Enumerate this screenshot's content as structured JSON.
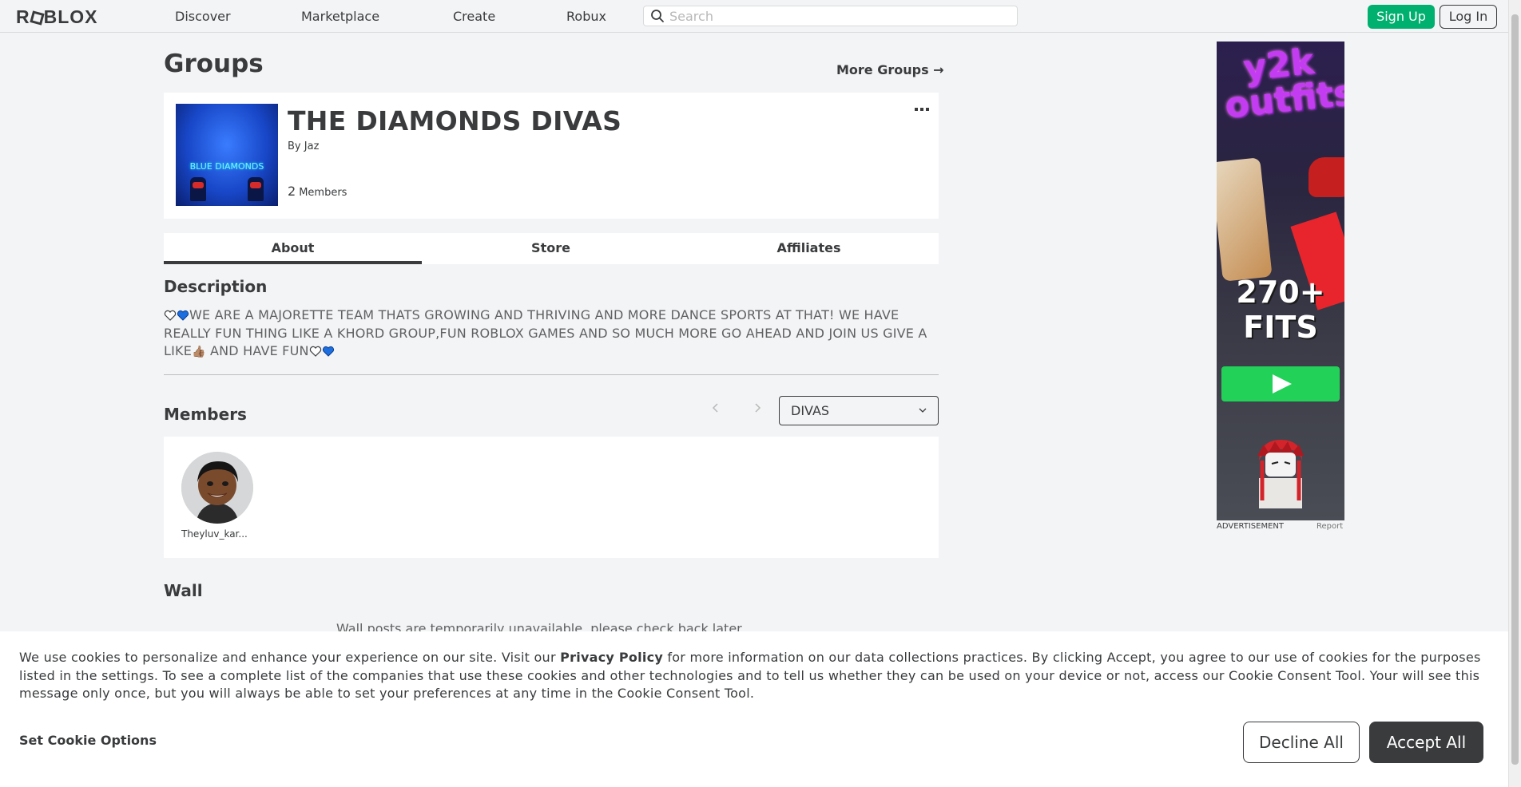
{
  "nav": {
    "logo": "ROBLOX",
    "logo_parts": [
      "R",
      "BLOX"
    ],
    "links": [
      "Discover",
      "Marketplace",
      "Create",
      "Robux"
    ],
    "search_placeholder": "Search",
    "signup": "Sign Up",
    "login": "Log In"
  },
  "page": {
    "title": "Groups",
    "more_groups": "More Groups →"
  },
  "group": {
    "name": "THE DIAMONDS DIVAS",
    "by_label": "By",
    "owner": "Jaz",
    "member_count": "2",
    "member_label": "Members",
    "emblem_text": "BLUE DIAMONDS"
  },
  "tabs": [
    "About",
    "Store",
    "Affiliates"
  ],
  "description": {
    "heading": "Description",
    "text_1": "WE ARE A MAJORETTE TEAM THATS GROWING AND THRIVING AND MORE DANCE SPORTS AT THAT! WE HAVE REALLY FUN THING LIKE A KHORD GROUP,FUN ROBLOX GAMES AND SO MUCH MORE GO AHEAD AND JOIN US GIVE A LIKE",
    "thumb": "👍🏽",
    "text_2": " AND HAVE FUN"
  },
  "members": {
    "heading": "Members",
    "role_selected": "DIVAS",
    "list": [
      {
        "name": "Theyluv_kar..."
      }
    ]
  },
  "wall": {
    "heading": "Wall",
    "message": "Wall posts are temporarily unavailable, please check back later."
  },
  "ad": {
    "brand": "y2k outfits",
    "headline_1": "270+",
    "headline_2": "FITS",
    "label": "ADVERTISEMENT",
    "report": "Report"
  },
  "cookie": {
    "text_before": "We use cookies to personalize and enhance your experience on our site. Visit our ",
    "privacy_link": "Privacy Policy",
    "text_after": " for more information on our data collections practices. By clicking Accept, you agree to our use of cookies for the purposes listed in the settings. To see a complete list of the companies that use these cookies and other technologies and to tell us whether they can be used on your device or not, access our Cookie Consent Tool. Your will see this message only once, but you will always be able to set your preferences at any time in the Cookie Consent Tool.",
    "set_options": "Set Cookie Options",
    "decline": "Decline All",
    "accept": "Accept All"
  },
  "colors": {
    "green": "#00b06f",
    "dark": "#393b3d",
    "background": "#f2f4f5",
    "heart_blue": "#1d6fe0"
  }
}
